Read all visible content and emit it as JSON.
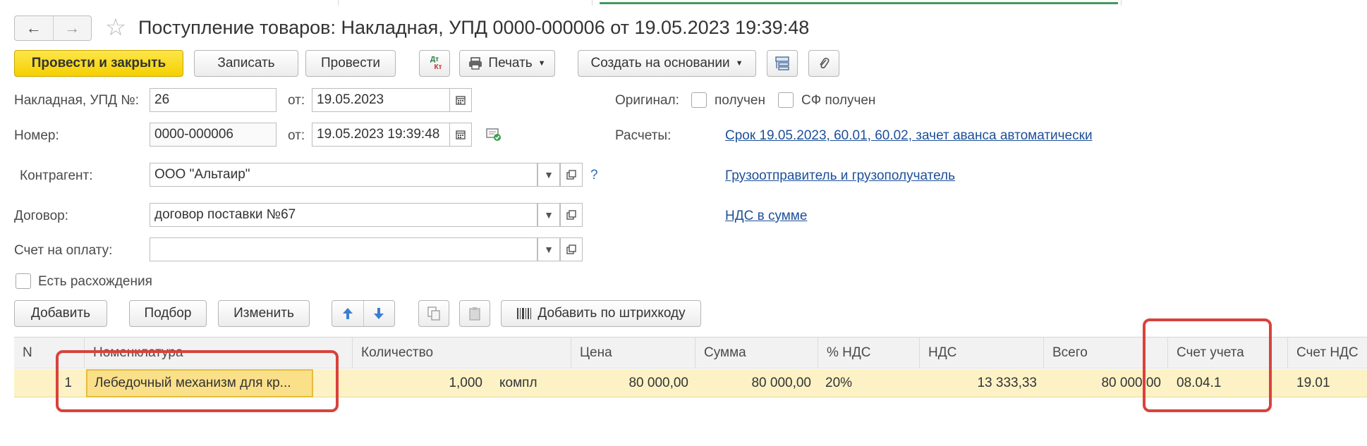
{
  "window": {
    "title": "Поступление товаров: Накладная, УПД 0000-000006 от 19.05.2023 19:39:48",
    "back_icon": "←",
    "forward_icon": "→",
    "favorite_icon": "☆"
  },
  "toolbar": {
    "post_close": "Провести и закрыть",
    "save": "Записать",
    "post": "Провести",
    "dtkt_icon": "ДтКт",
    "print": "Печать",
    "create_based": "Создать на основании",
    "structure_icon": "structure-icon",
    "attach_icon": "paperclip-icon"
  },
  "form": {
    "invoice_label": "Накладная, УПД №:",
    "invoice_value": "26",
    "from_label": "от:",
    "invoice_date": "19.05.2023",
    "number_label": "Номер:",
    "number_value": "0000-000006",
    "from_label2": "от:",
    "number_date": "19.05.2023 19:39:48",
    "counterparty_label": "Контрагент:",
    "counterparty_value": "ООО \"Альтаир\"",
    "question": "?",
    "contract_label": "Договор:",
    "contract_value": "договор поставки №67",
    "payment_invoice_label": "Счет на оплату:",
    "payment_invoice_value": "",
    "discrepancy_label": "Есть расхождения",
    "original_label": "Оригинал:",
    "received_label": "получен",
    "sf_received_label": "СФ получен",
    "settlements_label": "Расчеты:",
    "settlements_link": "Срок 19.05.2023, 60.01, 60.02, зачет аванса автоматически",
    "shipper_link": "Грузоотправитель и грузополучатель",
    "vat_link": "НДС в сумме"
  },
  "table_toolbar": {
    "add": "Добавить",
    "selection": "Подбор",
    "edit": "Изменить",
    "add_barcode": "Добавить по штрихкоду"
  },
  "table": {
    "headers": [
      "N",
      "Номенклатура",
      "Количество",
      "Цена",
      "Сумма",
      "% НДС",
      "НДС",
      "Всего",
      "Счет учета",
      "Счет НДС"
    ],
    "rows": [
      {
        "n": "1",
        "item": "Лебедочный механизм для кр...",
        "qty": "1,000",
        "unit": "компл",
        "price": "80 000,00",
        "sum": "80 000,00",
        "vat_rate": "20%",
        "vat": "13 333,33",
        "total": "80 000,00",
        "account": "08.04.1",
        "vat_account": "19.01"
      }
    ]
  },
  "colors": {
    "primary_button": "#f5d000",
    "link": "#1d4f9a",
    "highlight_box": "#d9423c",
    "selected_row": "#fcf2c6"
  }
}
